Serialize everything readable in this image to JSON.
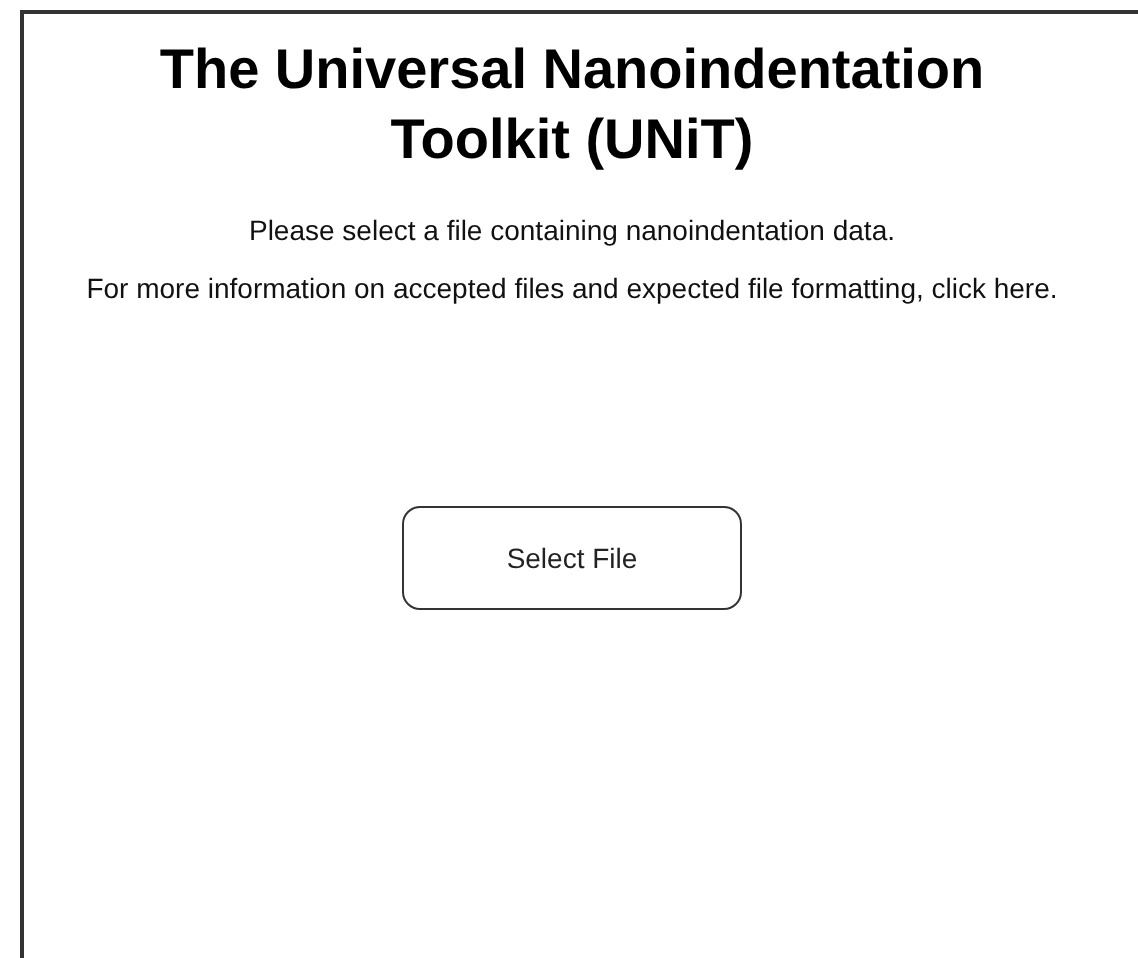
{
  "title": "The Universal Nanoindentation Toolkit (UNiT)",
  "prompt": "Please select a file containing nanoindentation data.",
  "info": "For more information on accepted files and expected file formatting, click here.",
  "buttons": [
    {
      "label": "Select File"
    }
  ]
}
